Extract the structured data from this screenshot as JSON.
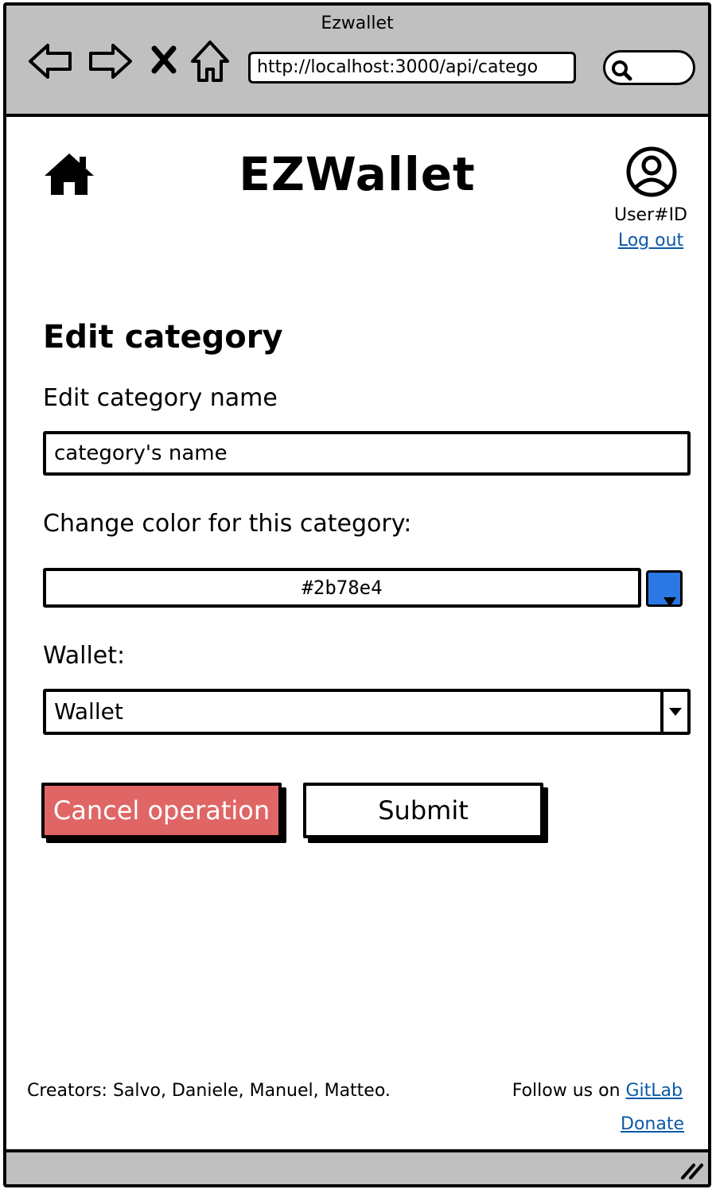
{
  "browser": {
    "title": "Ezwallet",
    "url": "http://localhost:3000/api/catego",
    "icons": [
      "back-arrow-icon",
      "forward-arrow-icon",
      "close-x-icon",
      "home-outline-icon",
      "search-icon",
      "resize-grip-icon"
    ]
  },
  "header": {
    "app_title": "EZWallet",
    "user_id": "User#ID",
    "logout_label": "Log out",
    "icons": [
      "home-icon",
      "user-avatar-icon"
    ]
  },
  "form": {
    "title": "Edit category",
    "name_label": "Edit category name",
    "name_value": "category's name",
    "color_label": "Change color for this category:",
    "color_value": "#2b78e4",
    "wallet_label": "Wallet:",
    "wallet_value": "Wallet",
    "cancel_label": "Cancel operation",
    "submit_label": "Submit"
  },
  "footer": {
    "creators": "Creators: Salvo, Daniele, Manuel, Matteo.",
    "follow_prefix": "Follow us on ",
    "follow_link": "GitLab",
    "donate": "Donate"
  },
  "colors": {
    "chrome": "#c0c0c0",
    "accent_swatch": "#2b78e4",
    "cancel_button": "#e06666",
    "link": "#0a5aa8"
  }
}
